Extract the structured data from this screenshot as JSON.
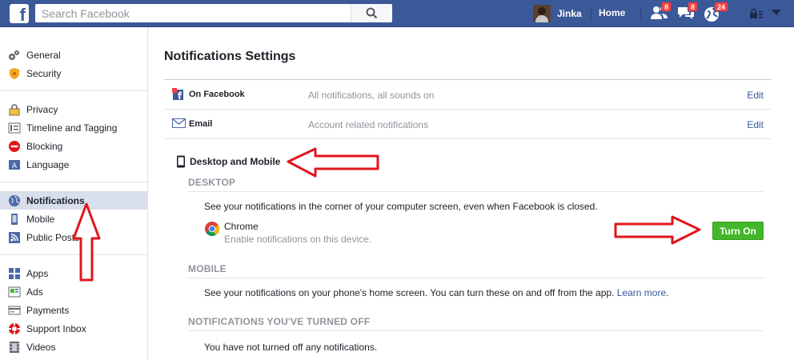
{
  "topbar": {
    "logo": "f",
    "search_placeholder": "Search Facebook",
    "user_name": "Jinka",
    "home_label": "Home",
    "friend_requests_count": "8",
    "messages_count": "8",
    "notifications_count": "24"
  },
  "sidebar": {
    "groups": [
      [
        {
          "label": "General",
          "icon": "gears-icon"
        },
        {
          "label": "Security",
          "icon": "shield-icon"
        }
      ],
      [
        {
          "label": "Privacy",
          "icon": "lock-icon"
        },
        {
          "label": "Timeline and Tagging",
          "icon": "timeline-icon"
        },
        {
          "label": "Blocking",
          "icon": "block-icon"
        },
        {
          "label": "Language",
          "icon": "language-icon"
        }
      ],
      [
        {
          "label": "Notifications",
          "icon": "globe-icon"
        },
        {
          "label": "Mobile",
          "icon": "mobile-icon"
        },
        {
          "label": "Public Posts",
          "icon": "rss-icon"
        }
      ],
      [
        {
          "label": "Apps",
          "icon": "apps-icon"
        },
        {
          "label": "Ads",
          "icon": "ads-icon"
        },
        {
          "label": "Payments",
          "icon": "card-icon"
        },
        {
          "label": "Support Inbox",
          "icon": "lifebuoy-icon"
        },
        {
          "label": "Videos",
          "icon": "film-icon"
        }
      ]
    ]
  },
  "main": {
    "title": "Notifications Settings",
    "on_facebook": {
      "label": "On Facebook",
      "desc": "All notifications, all sounds on",
      "edit": "Edit"
    },
    "email": {
      "label": "Email",
      "desc": "Account related notifications",
      "edit": "Edit"
    },
    "desktop_mobile": {
      "heading": "Desktop and Mobile",
      "desktop_head": "DESKTOP",
      "desktop_text": "See your notifications in the corner of your computer screen, even when Facebook is closed.",
      "chrome_name": "Chrome",
      "chrome_sub": "Enable notifications on this device.",
      "turn_on": "Turn On",
      "mobile_head": "MOBILE",
      "mobile_text": "See your notifications on your phone's home screen. You can turn these on and off from the app.",
      "learn_more": "Learn more",
      "period": ".",
      "off_head": "NOTIFICATIONS YOU'VE TURNED OFF",
      "off_text": "You have not turned off any notifications."
    }
  },
  "colors": {
    "brand": "#3b5998",
    "accent_green": "#42b72a",
    "badge_red": "#fa3e3e",
    "annotation_red": "#e0161b"
  }
}
